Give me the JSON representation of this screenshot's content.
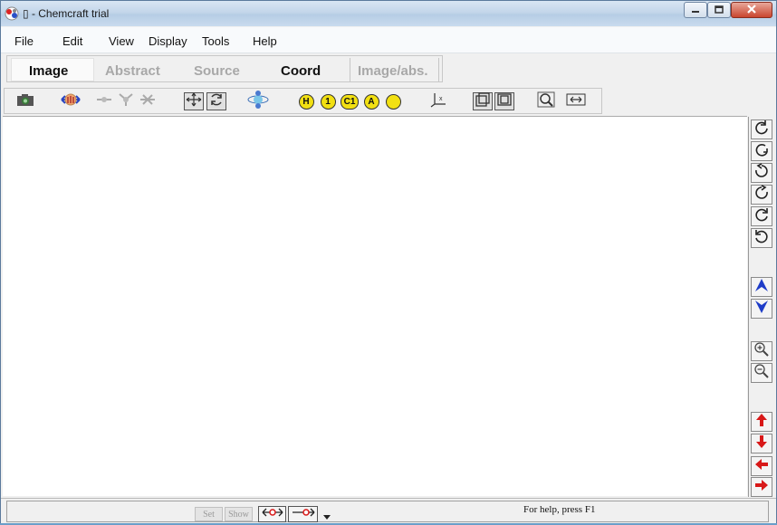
{
  "window": {
    "title": "▯ - Chemcraft trial",
    "app_icon": "chemcraft-logo-icon"
  },
  "menubar": {
    "items": [
      "File",
      "Edit",
      "View",
      "Display",
      "Tools",
      "Help"
    ]
  },
  "tabs": {
    "items": [
      "Image",
      "Abstract",
      "Source",
      "Coord",
      "Image/abs."
    ],
    "active": "Image"
  },
  "toolbar": {
    "icons": [
      "camera-icon",
      "rotate-molecule-icon",
      "add-bond-icon",
      "add-atom-icon",
      "delete-atom-icon",
      "fit-to-window-icon",
      "rotate-fit-icon",
      "orbital-icon",
      "label-h-icon",
      "label-number-icon",
      "label-c1-icon",
      "label-a-icon",
      "label-circle-icon",
      "axes-icon",
      "cube-perspective-icon",
      "cube-flat-icon",
      "magnifier-icon",
      "measure-icon"
    ],
    "labels": {
      "h": "H",
      "one": "1",
      "c1": "C1",
      "a": "A"
    }
  },
  "right_toolbar": {
    "icons": [
      "rotate-x-cw-icon",
      "rotate-x-ccw-icon",
      "rotate-y-cw-icon",
      "rotate-y-ccw-icon",
      "rotate-z-cw-icon",
      "rotate-z-ccw-icon",
      "move-forward-icon",
      "move-back-icon",
      "zoom-in-icon",
      "zoom-out-icon",
      "move-up-icon",
      "move-down-icon",
      "move-left-icon",
      "move-right-icon"
    ]
  },
  "status": {
    "set_label": "Set",
    "show_label": "Show",
    "help_text": "For help, press F1"
  },
  "colors": {
    "accent": "#1e3cc8",
    "arrow_red": "#d81818",
    "label_yellow": "#f2e012"
  }
}
